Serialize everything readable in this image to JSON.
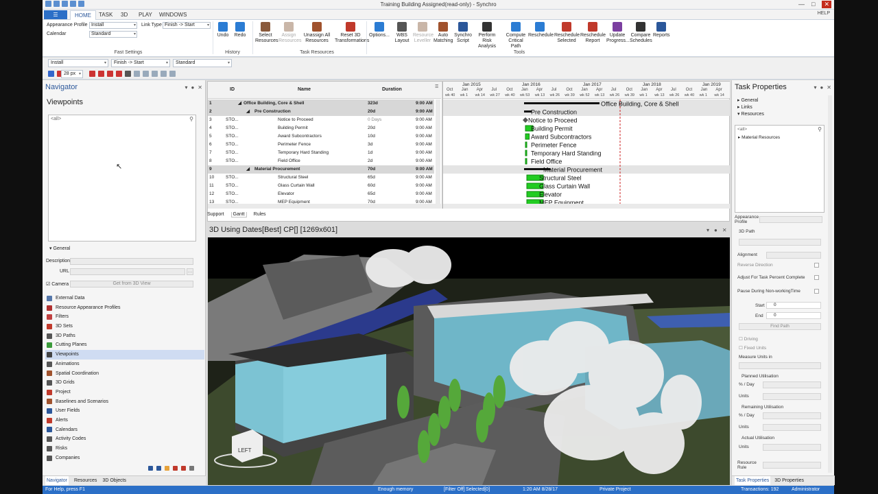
{
  "window": {
    "title": "Training Building Assigned(read-only) - Synchro"
  },
  "ribbon_tabs": [
    {
      "label": "HOME"
    },
    {
      "label": "TASK"
    },
    {
      "label": "3D"
    },
    {
      "label": "PLAY"
    },
    {
      "label": "WINDOWS"
    }
  ],
  "help_label": "HELP",
  "fast_settings": {
    "appearance_profile_label": "Appearance Profile",
    "appearance_profile_value": "Install",
    "calendar_label": "Calendar",
    "calendar_value": "Standard",
    "link_type_label": "Link Type",
    "link_type_value": "Finish -> Start",
    "group_label": "Fast Settings"
  },
  "history": {
    "undo": "Undo",
    "redo": "Redo",
    "group_label": "History"
  },
  "task_resources": {
    "buttons": [
      {
        "label": "Select Resources",
        "icon": "select-resources-icon",
        "color": "#8a5a3c"
      },
      {
        "label": "Assign Resources",
        "icon": "assign-resources-icon",
        "color": "#c9b6a8",
        "disabled": true
      },
      {
        "label": "Unassign All Resources",
        "icon": "unassign-resources-icon",
        "color": "#a0522d"
      },
      {
        "label": "Reset 3D Transformations",
        "icon": "reset-3d-icon",
        "color": "#c0392b"
      }
    ],
    "group_label": "Task Resources"
  },
  "tools": {
    "buttons": [
      {
        "label": "Options...",
        "icon": "gear-icon",
        "color": "#2b7cd3"
      },
      {
        "label": "WBS Layout",
        "icon": "wbs-layout-icon",
        "color": "#555555"
      },
      {
        "label": "Resource Leveller",
        "icon": "resource-leveller-icon",
        "color": "#c9b6a8",
        "disabled": true
      },
      {
        "label": "Auto Matching",
        "icon": "auto-matching-icon",
        "color": "#a0522d"
      },
      {
        "label": "Synchro Script",
        "icon": "script-icon",
        "color": "#2b579a"
      },
      {
        "label": "Perform Risk Analysis",
        "icon": "risk-analysis-icon",
        "color": "#333333"
      },
      {
        "label": "Compute Critical Path",
        "icon": "critical-path-icon",
        "color": "#2b7cd3"
      },
      {
        "label": "Reschedule",
        "icon": "reschedule-icon",
        "color": "#2b7cd3"
      },
      {
        "label": "Reschedule Selected",
        "icon": "reschedule-selected-icon",
        "color": "#c0392b"
      },
      {
        "label": "Reschedule Report",
        "icon": "reschedule-report-icon",
        "color": "#c0392b"
      },
      {
        "label": "Update Progress...",
        "icon": "update-progress-icon",
        "color": "#7b3fa0"
      },
      {
        "label": "Compare Schedules",
        "icon": "compare-schedules-icon",
        "color": "#333333"
      },
      {
        "label": "Reports",
        "icon": "reports-icon",
        "color": "#2b579a"
      }
    ],
    "group_label": "Tools"
  },
  "toolbar": {
    "profile_value": "Install",
    "link_value": "Finish -> Start",
    "calendar_value": "Standard",
    "zoom_value": "28 px"
  },
  "navigator": {
    "title": "Navigator",
    "section": "Viewpoints",
    "filter_placeholder": "<all>",
    "general_label": "General",
    "description_label": "Description",
    "url_label": "URL",
    "camera_label": "Camera",
    "get_from_3d_label": "Get from 3D View",
    "items": [
      {
        "label": "External Data",
        "icon": "external-data-icon",
        "color": "#5577aa"
      },
      {
        "label": "Resource Appearance Profiles",
        "icon": "appearance-profiles-icon",
        "color": "#b03030"
      },
      {
        "label": "Filters",
        "icon": "filter-icon",
        "color": "#c04040"
      },
      {
        "label": "3D Sets",
        "icon": "3d-sets-icon",
        "color": "#c0392b"
      },
      {
        "label": "3D Paths",
        "icon": "3d-paths-icon",
        "color": "#555555"
      },
      {
        "label": "Cutting Planes",
        "icon": "cutting-planes-icon",
        "color": "#3a9a3a"
      },
      {
        "label": "Viewpoints",
        "icon": "viewpoints-icon",
        "color": "#444444",
        "active": true
      },
      {
        "label": "Animations",
        "icon": "animations-icon",
        "color": "#555555"
      },
      {
        "label": "Spatial Coordination",
        "icon": "spatial-coordination-icon",
        "color": "#a0522d"
      },
      {
        "label": "3D Grids",
        "icon": "3d-grids-icon",
        "color": "#555555"
      },
      {
        "label": "Project",
        "icon": "project-icon",
        "color": "#c0392b"
      },
      {
        "label": "Baselines and Scenarios",
        "icon": "baselines-icon",
        "color": "#a0522d"
      },
      {
        "label": "User Fields",
        "icon": "user-fields-icon",
        "color": "#2b579a"
      },
      {
        "label": "Alerts",
        "icon": "alert-icon",
        "color": "#c0392b"
      },
      {
        "label": "Calendars",
        "icon": "calendar-icon",
        "color": "#2b579a"
      },
      {
        "label": "Activity Codes",
        "icon": "activity-codes-icon",
        "color": "#555555"
      },
      {
        "label": "Risks",
        "icon": "risks-icon",
        "color": "#555555"
      },
      {
        "label": "Companies",
        "icon": "companies-icon",
        "color": "#555555"
      }
    ],
    "tabs": [
      {
        "label": "Navigator",
        "active": true
      },
      {
        "label": "Resources"
      },
      {
        "label": "3D Objects"
      }
    ]
  },
  "gantt": {
    "columns": {
      "id": "ID",
      "name": "Name",
      "duration": "Duration"
    },
    "rows": [
      {
        "num": "1",
        "id": "",
        "name": "Office Building, Core & Shell",
        "duration": "323d",
        "start": "9:00 AM",
        "level": 0,
        "summary": true
      },
      {
        "num": "2",
        "id": "",
        "name": "Pre Construction",
        "duration": "20d",
        "start": "9:00 AM",
        "level": 1,
        "summary": true
      },
      {
        "num": "3",
        "id": "STO...",
        "name": "Notice to Proceed",
        "duration": "0 Days",
        "start": "9:00 AM",
        "level": 2
      },
      {
        "num": "4",
        "id": "STO...",
        "name": "Building Permit",
        "duration": "20d",
        "start": "9:00 AM",
        "level": 2
      },
      {
        "num": "5",
        "id": "STO...",
        "name": "Award Subcontractors",
        "duration": "10d",
        "start": "9:00 AM",
        "level": 2
      },
      {
        "num": "6",
        "id": "STO...",
        "name": "Perimeter Fence",
        "duration": "3d",
        "start": "9:00 AM",
        "level": 2
      },
      {
        "num": "7",
        "id": "STO...",
        "name": "Temporary Hard Standing",
        "duration": "1d",
        "start": "9:00 AM",
        "level": 2
      },
      {
        "num": "8",
        "id": "STO...",
        "name": "Field Office",
        "duration": "2d",
        "start": "9:00 AM",
        "level": 2
      },
      {
        "num": "9",
        "id": "",
        "name": "Material Procurement",
        "duration": "70d",
        "start": "9:00 AM",
        "level": 1,
        "summary": true
      },
      {
        "num": "10",
        "id": "STO...",
        "name": "Structural Steel",
        "duration": "65d",
        "start": "9:00 AM",
        "level": 2
      },
      {
        "num": "11",
        "id": "STO...",
        "name": "Glass Curtain Wall",
        "duration": "60d",
        "start": "9:00 AM",
        "level": 2
      },
      {
        "num": "12",
        "id": "STO...",
        "name": "Elevator",
        "duration": "65d",
        "start": "9:00 AM",
        "level": 2
      },
      {
        "num": "13",
        "id": "STO...",
        "name": "MEP Equipment",
        "duration": "70d",
        "start": "9:00 AM",
        "level": 2
      }
    ],
    "timeline": {
      "years": [
        "Jan 2015",
        "Jan 2016",
        "Jan 2017",
        "Jan 2018",
        "Jan 2019"
      ],
      "months": [
        "Oct",
        "Jan",
        "Apr",
        "Jul",
        "Oct",
        "Jan",
        "Apr",
        "Jul",
        "Oct",
        "Jan",
        "Apr",
        "Jul",
        "Oct",
        "Jan",
        "Apr",
        "Jul",
        "Oct",
        "Jan",
        "Apr"
      ],
      "weeks": [
        "wk 40",
        "wk 1",
        "wk 14",
        "wk 27",
        "wk 40",
        "wk 53",
        "wk 13",
        "wk 26",
        "wk 39",
        "wk 52",
        "wk 13",
        "wk 26",
        "wk 39",
        "wk 1",
        "wk 13",
        "wk 26",
        "wk 40",
        "wk 1",
        "wk 14"
      ]
    },
    "tabs": [
      {
        "label": "Support"
      },
      {
        "label": "Gantt",
        "active": true
      },
      {
        "label": "Rules"
      }
    ]
  },
  "view3d": {
    "title": "3D Using Dates[Best] CP[] [1269x601]",
    "orientation_label": "LEFT"
  },
  "task_properties": {
    "title": "Task Properties",
    "tree": [
      "General",
      "Links",
      "Resources"
    ],
    "list_placeholder": "<all>",
    "list_item": "Material Resources",
    "appearance_profile_label": "Appearance Profile",
    "path_3d_label": "3D Path",
    "alignment_label": "Alignment",
    "reverse_direction_label": "Reverse Direction",
    "adjust_label": "Adjust For Task Percent Complete",
    "pause_label": "Pause During Non-workingTime",
    "start_label": "Start",
    "start_value": "0",
    "end_label": "End",
    "end_value": "0",
    "find_path_label": "Find Path",
    "driving_label": "Driving",
    "fixed_units_label": "Fixed Units",
    "measure_units_label": "Measure Units in",
    "planned_util_label": "Planned Utilisation",
    "remaining_util_label": "Remaining Utilisation",
    "actual_util_label": "Actual Utilisation",
    "per_day_label": "% / Day",
    "units_label": "Units",
    "resource_rule_label": "Resource Rule",
    "tabs": [
      {
        "label": "Task Properties",
        "active": true
      },
      {
        "label": "3D Properties"
      }
    ]
  },
  "statusbar": {
    "help": "For Help, press F1",
    "memory": "Enough memory",
    "filter": "[Filter Off]",
    "selected": "Selected[0]",
    "datetime": "1:20 AM 8/28/17",
    "project": "Private Project",
    "transactions": "Transactions: 192",
    "user": "Administrator"
  },
  "colors": {
    "accent": "#2b6fc7",
    "gantt_bar": "#22cc22",
    "critical_line": "#cc2222"
  }
}
